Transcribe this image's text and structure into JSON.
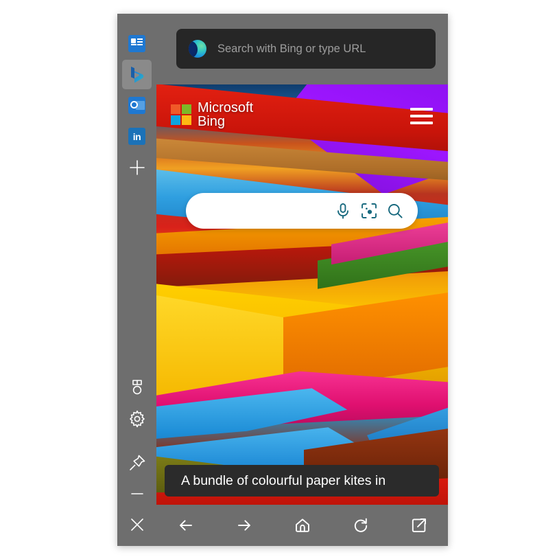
{
  "window": {
    "title": "Microsoft Edge Bing sidebar pane"
  },
  "urlbar": {
    "placeholder": "Search with Bing or type URL",
    "value": "",
    "edge_icon": "edge-logo-icon"
  },
  "sidebar": {
    "items": [
      {
        "name": "browser-essentials",
        "icon": "news-feed-icon",
        "selected": false
      },
      {
        "name": "bing-discover",
        "icon": "bing-icon",
        "selected": true
      },
      {
        "name": "outlook",
        "icon": "outlook-icon",
        "selected": false
      },
      {
        "name": "linkedin",
        "icon": "linkedin-icon",
        "label": "in",
        "selected": false
      },
      {
        "name": "add-app",
        "icon": "plus-icon",
        "selected": false
      }
    ],
    "bottom_items": [
      {
        "name": "rewards",
        "icon": "medal-icon"
      },
      {
        "name": "settings",
        "icon": "gear-icon"
      },
      {
        "name": "pin-pane",
        "icon": "pin-icon"
      },
      {
        "name": "minimize",
        "icon": "minimize-icon"
      },
      {
        "name": "close",
        "icon": "close-icon"
      }
    ]
  },
  "bing_page": {
    "brand": {
      "line1": "Microsoft",
      "line2": "Bing",
      "squares": [
        "#f05a28",
        "#7db827",
        "#0ea3e0",
        "#fdb913"
      ]
    },
    "menu_icon": "hamburger-icon",
    "search": {
      "value": "",
      "placeholder": "",
      "icons": [
        {
          "name": "microphone-icon"
        },
        {
          "name": "visual-search-icon"
        },
        {
          "name": "search-icon"
        }
      ]
    },
    "caption": "A bundle of colourful paper kites in",
    "image_alt": "Stacked bundle of brightly coloured paper kites"
  },
  "navbar": {
    "items": [
      {
        "name": "back",
        "icon": "arrow-left-icon"
      },
      {
        "name": "forward",
        "icon": "arrow-right-icon"
      },
      {
        "name": "home",
        "icon": "home-icon"
      },
      {
        "name": "refresh",
        "icon": "refresh-icon"
      },
      {
        "name": "open-in-browser",
        "icon": "open-external-icon"
      }
    ]
  },
  "colors": {
    "chrome": "#6e6e6e",
    "urlbar": "#262626",
    "caption_bg": "#2b2b2b",
    "accent_teal": "#17697e",
    "selected_tile": "#8a8a8a"
  }
}
